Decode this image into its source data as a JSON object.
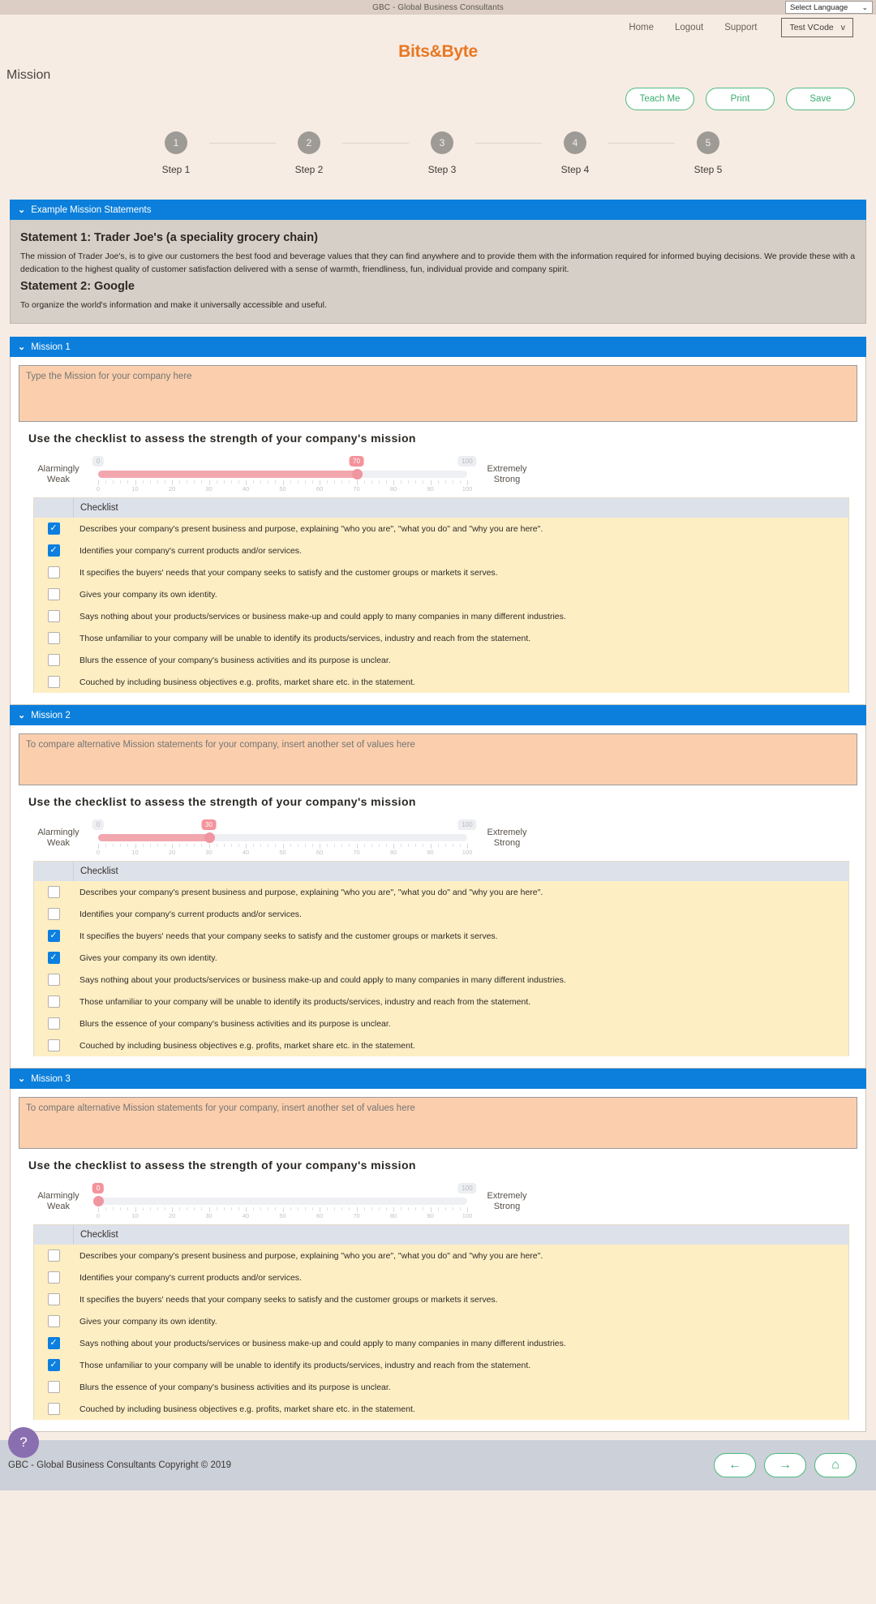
{
  "topbar": {
    "site_title": "GBC - Global Business Consultants",
    "language_selector": "Select Language",
    "language_chevron": "chevron-down-icon"
  },
  "nav": {
    "links": [
      "Home",
      "Logout",
      "Support"
    ],
    "user_code": "Test VCode",
    "user_chevron": "v"
  },
  "brand": {
    "name": "Bits&Byte",
    "color": "#e87722"
  },
  "page": {
    "title": "Mission"
  },
  "actions": [
    {
      "label": "Teach Me",
      "name": "teach-me-button"
    },
    {
      "label": "Print",
      "name": "print-button"
    },
    {
      "label": "Save",
      "name": "save-button"
    }
  ],
  "steps": [
    {
      "number": "1",
      "label": "Step 1"
    },
    {
      "number": "2",
      "label": "Step 2"
    },
    {
      "number": "3",
      "label": "Step 3"
    },
    {
      "number": "4",
      "label": "Step 4"
    },
    {
      "number": "5",
      "label": "Step 5"
    }
  ],
  "examples": {
    "header": "Example Mission Statements",
    "statement1_title": "Statement 1: Trader Joe's (a speciality grocery chain)",
    "statement1_text": "The mission of Trader Joe's, is to give our customers the best food and beverage values that they can find anywhere and to provide them with the information required for informed buying decisions. We provide these with a dedication to the highest quality of customer satisfaction delivered with a sense of warmth, friendliness, fun, individual provide and company spirit.",
    "statement2_title": "Statement 2: Google",
    "statement2_text": "To organize the world's information and make it universally accessible and useful."
  },
  "checklist_heading": "Use the checklist to assess the strength of your company's mission",
  "checklist_column_header": "Checklist",
  "slider_labels": {
    "low": "Alarmingly Weak",
    "low_line1": "Alarmingly",
    "low_line2": "Weak",
    "high_line1": "Extremely",
    "high_line2": "Strong",
    "min": "0",
    "max": "100",
    "ticks": [
      "0",
      "10",
      "20",
      "30",
      "40",
      "50",
      "60",
      "70",
      "80",
      "90",
      "100"
    ]
  },
  "checklist_items": [
    "Describes your company's present business and purpose, explaining \"who you are\", \"what you do\" and \"why you are here\".",
    "Identifies your company's current products and/or services.",
    "It specifies the buyers' needs that your company seeks to satisfy and the customer groups or markets it serves.",
    "Gives your company its own identity.",
    "Says nothing about your products/services or business make-up and could apply to many companies in many different industries.",
    "Those unfamiliar to your company will be unable to identify its products/services, industry and reach from the statement.",
    "Blurs the essence of your company's business activities and its purpose is unclear.",
    "Couched by including business objectives e.g. profits, market share etc. in the statement."
  ],
  "missions": [
    {
      "header": "Mission 1",
      "placeholder": "Type the Mission for your company here",
      "value": "",
      "score": 70,
      "checked": [
        true,
        true,
        false,
        false,
        false,
        false,
        false,
        false
      ]
    },
    {
      "header": "Mission 2",
      "placeholder": "To compare alternative Mission statements for your company, insert another set of values here",
      "value": "",
      "score": 30,
      "checked": [
        false,
        false,
        true,
        true,
        false,
        false,
        false,
        false
      ]
    },
    {
      "header": "Mission 3",
      "placeholder": "To compare alternative Mission statements for your company, insert another set of values here",
      "value": "",
      "score": 0,
      "checked": [
        false,
        false,
        false,
        false,
        true,
        true,
        false,
        false
      ]
    }
  ],
  "footer": {
    "copyright": "GBC - Global Business Consultants Copyright © 2019",
    "prev_icon": "←",
    "next_icon": "→",
    "home_icon": "⌂",
    "help_icon": "?"
  }
}
